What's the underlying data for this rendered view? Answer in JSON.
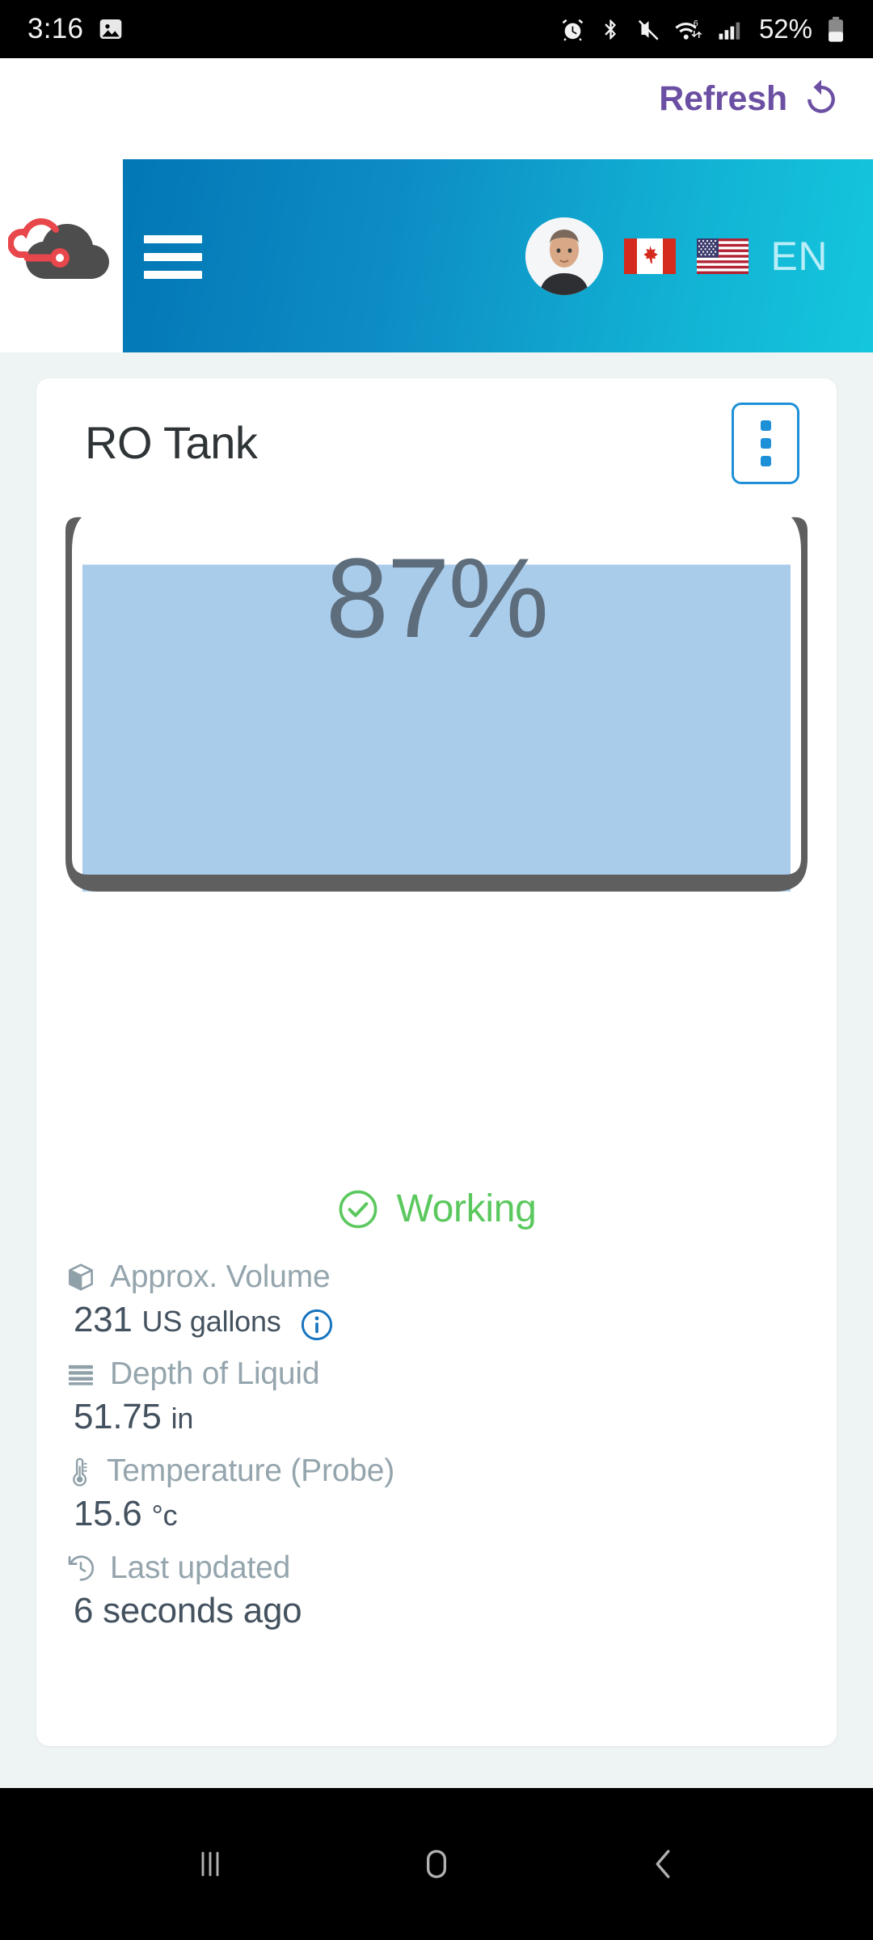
{
  "status_bar": {
    "time": "3:16",
    "battery_percent": "52%",
    "icons": [
      "image-notification-icon",
      "alarm-icon",
      "bluetooth-icon",
      "mute-icon",
      "wifi-6-icon",
      "cellular-signal-icon",
      "battery-icon"
    ]
  },
  "refresh": {
    "label": "Refresh",
    "icon": "refresh-icon",
    "color": "#6b4fa2"
  },
  "header": {
    "logo": "cloud-logo",
    "menu_icon": "hamburger-menu-icon",
    "avatar": "user-avatar",
    "flags": [
      "canada-flag",
      "usa-flag"
    ],
    "language": "EN",
    "gradient_start": "#0277b5",
    "gradient_end": "#14c6dd"
  },
  "card": {
    "title": "RO Tank",
    "menu_icon": "kebab-menu-icon",
    "menu_border_color": "#1e90d8"
  },
  "tank": {
    "percent_label": "87%",
    "fill_percent": 87,
    "wall_color": "#605f5f",
    "liquid_color": "#aacceb",
    "percent_text_color": "#5d6d7c"
  },
  "status": {
    "icon": "check-circle-icon",
    "text": "Working",
    "color": "#5bc85e"
  },
  "metrics": [
    {
      "icon": "cube-icon",
      "label": "Approx. Volume",
      "value": "231",
      "unit": "US gallons",
      "info_icon": "info-icon"
    },
    {
      "icon": "layers-icon",
      "label": "Depth of Liquid",
      "value": "51.75",
      "unit": "in",
      "info_icon": null
    },
    {
      "icon": "thermometer-icon",
      "label": "Temperature (Probe)",
      "value": "15.6",
      "unit": "°c",
      "info_icon": null
    },
    {
      "icon": "history-icon",
      "label": "Last updated",
      "value": "6 seconds ago",
      "unit": "",
      "info_icon": null
    }
  ],
  "nav_bar": {
    "recents": "recents-icon",
    "home": "home-icon",
    "back": "back-icon"
  }
}
